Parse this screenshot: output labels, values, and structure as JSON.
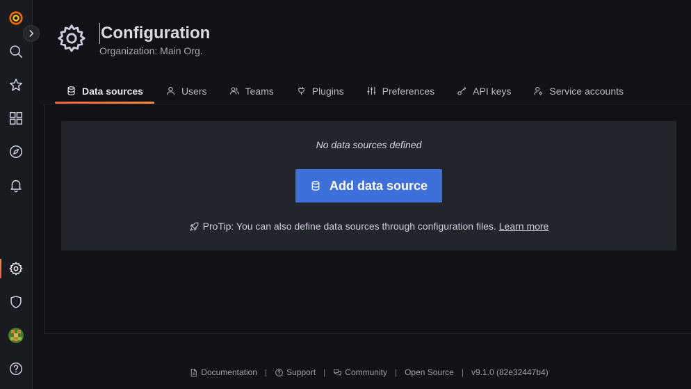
{
  "page": {
    "title": "Configuration",
    "subtitle": "Organization: Main Org."
  },
  "tabs": [
    {
      "label": "Data sources",
      "icon": "database-icon",
      "active": true
    },
    {
      "label": "Users",
      "icon": "user-icon"
    },
    {
      "label": "Teams",
      "icon": "users-icon"
    },
    {
      "label": "Plugins",
      "icon": "plug-icon"
    },
    {
      "label": "Preferences",
      "icon": "sliders-icon"
    },
    {
      "label": "API keys",
      "icon": "key-icon"
    },
    {
      "label": "Service accounts",
      "icon": "user-cog-icon"
    }
  ],
  "empty_state": {
    "title": "No data sources defined",
    "button_label": "Add data source",
    "protip_text": "ProTip: You can also define data sources through configuration files.",
    "protip_link": "Learn more"
  },
  "footer": {
    "documentation": "Documentation",
    "support": "Support",
    "community": "Community",
    "open_source": "Open Source",
    "version": "v9.1.0 (82e32447b4)"
  },
  "sidebar": {
    "items": [
      "grafana-logo",
      "search-icon",
      "star-icon",
      "dashboards-icon",
      "explore-icon",
      "alerting-icon",
      "configuration-icon",
      "shield-icon",
      "avatar",
      "help-icon"
    ],
    "active": "configuration-icon"
  },
  "colors": {
    "accent_orange": "#f55f3e",
    "primary_blue": "#3d71d9",
    "background": "#111217",
    "card": "#22252b"
  }
}
